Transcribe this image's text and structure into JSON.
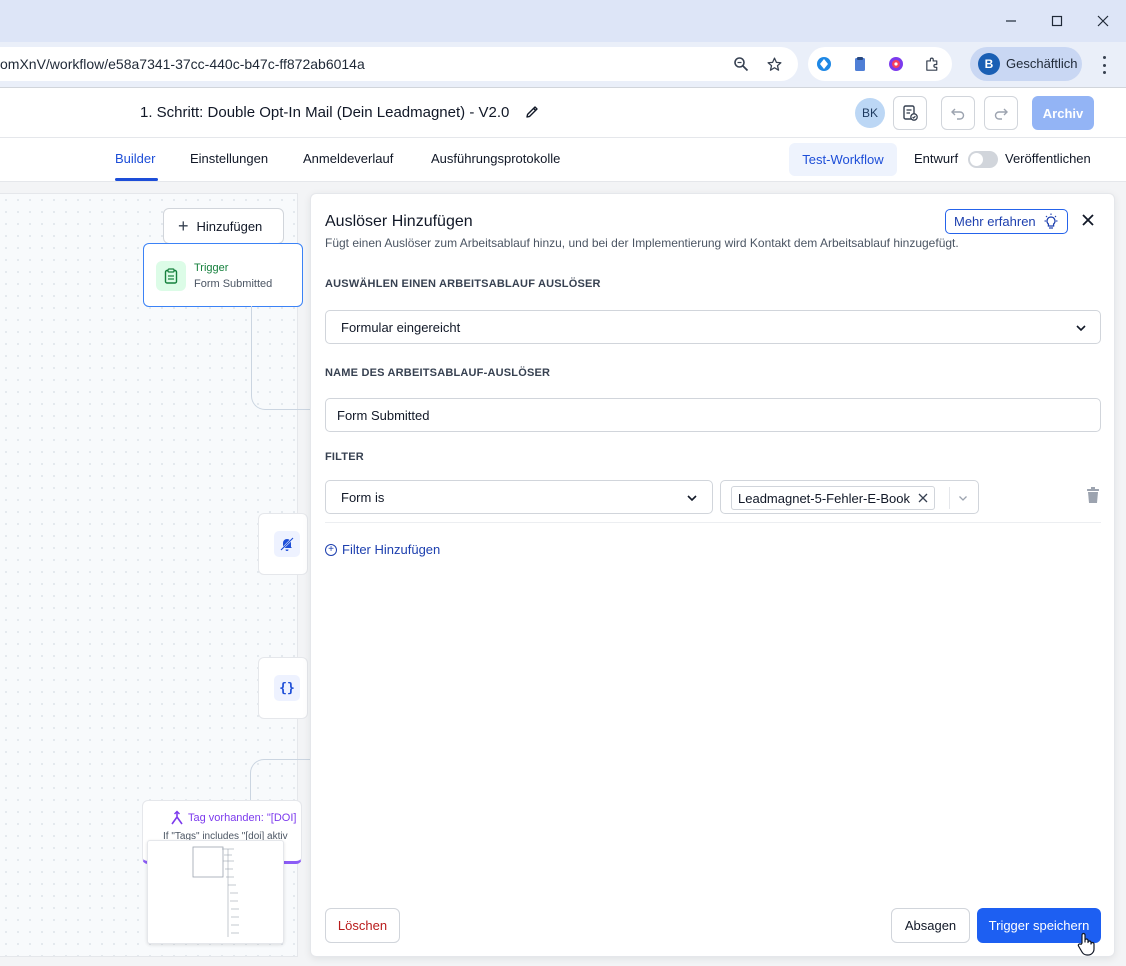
{
  "browser": {
    "url": "omXnV/workflow/e58a7341-37cc-440c-b47c-ff872ab6014a",
    "profile_initial": "B",
    "profile_label": "Geschäftlich"
  },
  "header": {
    "workflow_title": "1. Schritt: Double Opt-In Mail (Dein Leadmagnet) - V2.0",
    "user_initials": "BK",
    "archive_label": "Archiv"
  },
  "tabs": [
    {
      "label": "Builder",
      "active": true
    },
    {
      "label": "Einstellungen",
      "active": false
    },
    {
      "label": "Anmeldeverlauf",
      "active": false
    },
    {
      "label": "Ausführungsprotokolle",
      "active": false
    }
  ],
  "toolbar": {
    "test_workflow_label": "Test-Workflow",
    "draft_label": "Entwurf",
    "publish_label": "Veröffentlichen"
  },
  "canvas": {
    "add_label": "Hinzufügen",
    "trigger_title": "Trigger",
    "trigger_subtitle": "Form Submitted",
    "tag_node_title": "Tag vorhanden: \"[DOI]",
    "tag_node_subtitle": "If \"Tags\" includes \"[doi] aktiv"
  },
  "panel": {
    "title": "Auslöser Hinzufügen",
    "description": "Fügt einen Auslöser zum Arbeitsablauf hinzu, und bei der Implementierung wird Kontakt dem Arbeitsablauf hinzugefügt.",
    "learn_more_label": "Mehr erfahren",
    "trigger_section_label": "AUSWÄHLEN EINEN ARBEITSABLAUF AUSLÖSER",
    "trigger_selected": "Formular eingereicht",
    "name_section_label": "NAME DES ARBEITSABLAUF-AUSLÖSER",
    "name_value": "Form Submitted",
    "filter_section_label": "FILTER",
    "filter_field": "Form is",
    "filter_value_chip": "Leadmagnet-5-Fehler-E-Book",
    "add_filter_label": "Filter Hinzufügen",
    "delete_label": "Löschen",
    "cancel_label": "Absagen",
    "save_label": "Trigger speichern"
  },
  "colors": {
    "primary": "#1d5ff2",
    "active_tab": "#1d4ed8",
    "danger": "#b91c1c",
    "trigger_green": "#15803d",
    "condition_purple": "#7c3aed"
  }
}
